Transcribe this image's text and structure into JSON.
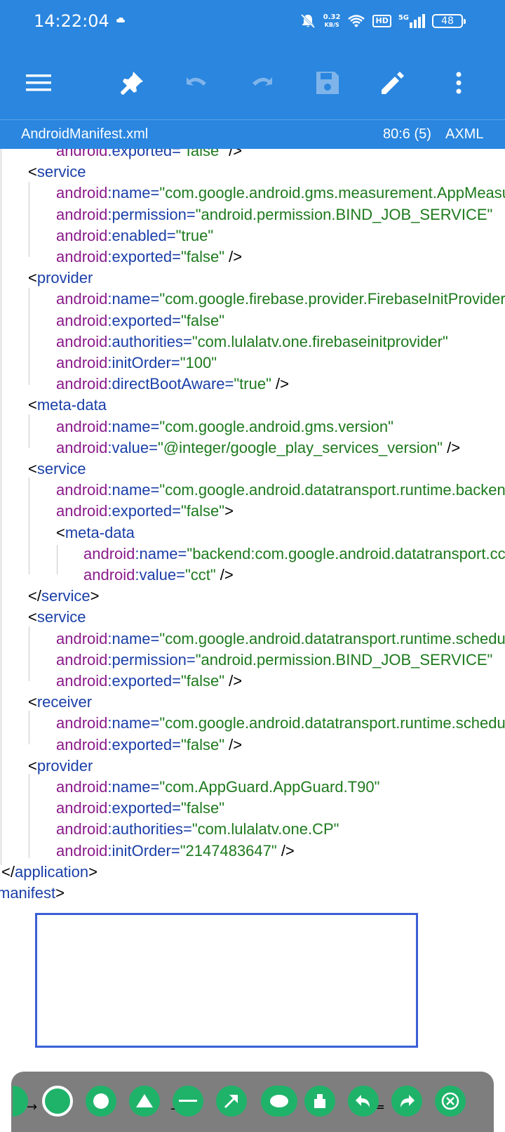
{
  "status_bar": {
    "time": "14:22:04",
    "net_speed_value": "0.32",
    "net_speed_unit": "KB/S",
    "hd_label": "HD",
    "network_label": "5G",
    "battery": "48"
  },
  "toolbar": {
    "icons": [
      "menu-icon",
      "pin-icon",
      "undo-icon",
      "redo-icon",
      "save-icon",
      "edit-icon",
      "more-vert-icon"
    ]
  },
  "file_bar": {
    "filename": "AndroidManifest.xml",
    "cursor_position": "80:6 (5)",
    "file_type": "AXML"
  },
  "code_lines": [
    {
      "indent": 2,
      "parts": [
        {
          "t": "attr",
          "v": "android"
        },
        {
          "t": "tag",
          "v": ":exported="
        },
        {
          "t": "val",
          "v": "\"false\""
        },
        {
          "t": "plain",
          "v": " />"
        }
      ]
    },
    {
      "indent": 1,
      "parts": [
        {
          "t": "plain",
          "v": "<"
        },
        {
          "t": "tag",
          "v": "service"
        }
      ]
    },
    {
      "indent": 2,
      "parts": [
        {
          "t": "attr",
          "v": "android"
        },
        {
          "t": "tag",
          "v": ":name="
        },
        {
          "t": "val",
          "v": "\"com.google.android.gms.measurement.AppMeasurementJobService\""
        }
      ]
    },
    {
      "indent": 2,
      "parts": [
        {
          "t": "attr",
          "v": "android"
        },
        {
          "t": "tag",
          "v": ":permission="
        },
        {
          "t": "val",
          "v": "\"android.permission.BIND_JOB_SERVICE\""
        }
      ]
    },
    {
      "indent": 2,
      "parts": [
        {
          "t": "attr",
          "v": "android"
        },
        {
          "t": "tag",
          "v": ":enabled="
        },
        {
          "t": "val",
          "v": "\"true\""
        }
      ]
    },
    {
      "indent": 2,
      "parts": [
        {
          "t": "attr",
          "v": "android"
        },
        {
          "t": "tag",
          "v": ":exported="
        },
        {
          "t": "val",
          "v": "\"false\""
        },
        {
          "t": "plain",
          "v": " />"
        }
      ]
    },
    {
      "indent": 1,
      "parts": [
        {
          "t": "plain",
          "v": "<"
        },
        {
          "t": "tag",
          "v": "provider"
        }
      ]
    },
    {
      "indent": 2,
      "parts": [
        {
          "t": "attr",
          "v": "android"
        },
        {
          "t": "tag",
          "v": ":name="
        },
        {
          "t": "val",
          "v": "\"com.google.firebase.provider.FirebaseInitProvider\""
        }
      ]
    },
    {
      "indent": 2,
      "parts": [
        {
          "t": "attr",
          "v": "android"
        },
        {
          "t": "tag",
          "v": ":exported="
        },
        {
          "t": "val",
          "v": "\"false\""
        }
      ]
    },
    {
      "indent": 2,
      "parts": [
        {
          "t": "attr",
          "v": "android"
        },
        {
          "t": "tag",
          "v": ":authorities="
        },
        {
          "t": "val",
          "v": "\"com.lulalatv.one.firebaseinitprovider\""
        }
      ]
    },
    {
      "indent": 2,
      "parts": [
        {
          "t": "attr",
          "v": "android"
        },
        {
          "t": "tag",
          "v": ":initOrder="
        },
        {
          "t": "val",
          "v": "\"100\""
        }
      ]
    },
    {
      "indent": 2,
      "parts": [
        {
          "t": "attr",
          "v": "android"
        },
        {
          "t": "tag",
          "v": ":directBootAware="
        },
        {
          "t": "val",
          "v": "\"true\""
        },
        {
          "t": "plain",
          "v": " />"
        }
      ]
    },
    {
      "indent": 1,
      "parts": [
        {
          "t": "plain",
          "v": "<"
        },
        {
          "t": "tag",
          "v": "meta-data"
        }
      ]
    },
    {
      "indent": 2,
      "parts": [
        {
          "t": "attr",
          "v": "android"
        },
        {
          "t": "tag",
          "v": ":name="
        },
        {
          "t": "val",
          "v": "\"com.google.android.gms.version\""
        }
      ]
    },
    {
      "indent": 2,
      "parts": [
        {
          "t": "attr",
          "v": "android"
        },
        {
          "t": "tag",
          "v": ":value="
        },
        {
          "t": "val",
          "v": "\"@integer/google_play_services_version\""
        },
        {
          "t": "plain",
          "v": " />"
        }
      ]
    },
    {
      "indent": 1,
      "parts": [
        {
          "t": "plain",
          "v": "<"
        },
        {
          "t": "tag",
          "v": "service"
        }
      ]
    },
    {
      "indent": 2,
      "parts": [
        {
          "t": "attr",
          "v": "android"
        },
        {
          "t": "tag",
          "v": ":name="
        },
        {
          "t": "val",
          "v": "\"com.google.android.datatransport.runtime.backends.TransportBackendDiscovery\""
        }
      ]
    },
    {
      "indent": 2,
      "parts": [
        {
          "t": "attr",
          "v": "android"
        },
        {
          "t": "tag",
          "v": ":exported="
        },
        {
          "t": "val",
          "v": "\"false\""
        },
        {
          "t": "plain",
          "v": ">"
        }
      ]
    },
    {
      "indent": 2,
      "parts": [
        {
          "t": "plain",
          "v": "<"
        },
        {
          "t": "tag",
          "v": "meta-data"
        }
      ]
    },
    {
      "indent": 3,
      "parts": [
        {
          "t": "attr",
          "v": "android"
        },
        {
          "t": "tag",
          "v": ":name="
        },
        {
          "t": "val",
          "v": "\"backend:com.google.android.datatransport.cct.CctBackendFactory\""
        }
      ]
    },
    {
      "indent": 3,
      "parts": [
        {
          "t": "attr",
          "v": "android"
        },
        {
          "t": "tag",
          "v": ":value="
        },
        {
          "t": "val",
          "v": "\"cct\""
        },
        {
          "t": "plain",
          "v": " />"
        }
      ]
    },
    {
      "indent": 1,
      "parts": [
        {
          "t": "plain",
          "v": "</"
        },
        {
          "t": "tag",
          "v": "service"
        },
        {
          "t": "plain",
          "v": ">"
        }
      ]
    },
    {
      "indent": 1,
      "parts": [
        {
          "t": "plain",
          "v": "<"
        },
        {
          "t": "tag",
          "v": "service"
        }
      ]
    },
    {
      "indent": 2,
      "parts": [
        {
          "t": "attr",
          "v": "android"
        },
        {
          "t": "tag",
          "v": ":name="
        },
        {
          "t": "val",
          "v": "\"com.google.android.datatransport.runtime.scheduling.jobscheduling.JobInfoSchedulerService\""
        }
      ]
    },
    {
      "indent": 2,
      "parts": [
        {
          "t": "attr",
          "v": "android"
        },
        {
          "t": "tag",
          "v": ":permission="
        },
        {
          "t": "val",
          "v": "\"android.permission.BIND_JOB_SERVICE\""
        }
      ]
    },
    {
      "indent": 2,
      "parts": [
        {
          "t": "attr",
          "v": "android"
        },
        {
          "t": "tag",
          "v": ":exported="
        },
        {
          "t": "val",
          "v": "\"false\""
        },
        {
          "t": "plain",
          "v": " />"
        }
      ]
    },
    {
      "indent": 1,
      "parts": [
        {
          "t": "plain",
          "v": "<"
        },
        {
          "t": "tag",
          "v": "receiver"
        }
      ]
    },
    {
      "indent": 2,
      "parts": [
        {
          "t": "attr",
          "v": "android"
        },
        {
          "t": "tag",
          "v": ":name="
        },
        {
          "t": "val",
          "v": "\"com.google.android.datatransport.runtime.scheduling.jobscheduling.AlarmManagerSchedulerBroadcastReceiver\""
        }
      ]
    },
    {
      "indent": 2,
      "parts": [
        {
          "t": "attr",
          "v": "android"
        },
        {
          "t": "tag",
          "v": ":exported="
        },
        {
          "t": "val",
          "v": "\"false\""
        },
        {
          "t": "plain",
          "v": " />"
        }
      ]
    },
    {
      "indent": 1,
      "parts": [
        {
          "t": "plain",
          "v": "<"
        },
        {
          "t": "tag",
          "v": "provider"
        }
      ]
    },
    {
      "indent": 2,
      "parts": [
        {
          "t": "attr",
          "v": "android"
        },
        {
          "t": "tag",
          "v": ":name="
        },
        {
          "t": "val",
          "v": "\"com.AppGuard.AppGuard.T90\""
        }
      ]
    },
    {
      "indent": 2,
      "parts": [
        {
          "t": "attr",
          "v": "android"
        },
        {
          "t": "tag",
          "v": ":exported="
        },
        {
          "t": "val",
          "v": "\"false\""
        }
      ]
    },
    {
      "indent": 2,
      "parts": [
        {
          "t": "attr",
          "v": "android"
        },
        {
          "t": "tag",
          "v": ":authorities="
        },
        {
          "t": "val",
          "v": "\"com.lulalatv.one.CP\""
        }
      ]
    },
    {
      "indent": 2,
      "parts": [
        {
          "t": "attr",
          "v": "android"
        },
        {
          "t": "tag",
          "v": ":initOrder="
        },
        {
          "t": "val",
          "v": "\"2147483647\""
        },
        {
          "t": "plain",
          "v": " />"
        }
      ]
    },
    {
      "indent": 0,
      "parts": [
        {
          "t": "plain",
          "v": "</"
        },
        {
          "t": "tag",
          "v": "application"
        },
        {
          "t": "plain",
          "v": ">"
        }
      ]
    },
    {
      "indent": -1,
      "parts": [
        {
          "t": "tag",
          "v": "manifest"
        },
        {
          "t": "plain",
          "v": ">"
        }
      ]
    }
  ],
  "draw_toolbar": {
    "tools": [
      "square-icon",
      "circle-icon",
      "triangle-icon",
      "line-icon",
      "arrow-icon",
      "ellipse-icon",
      "eraser-icon",
      "undo-icon",
      "redo-icon",
      "close-icon"
    ],
    "selected": "square-icon"
  }
}
